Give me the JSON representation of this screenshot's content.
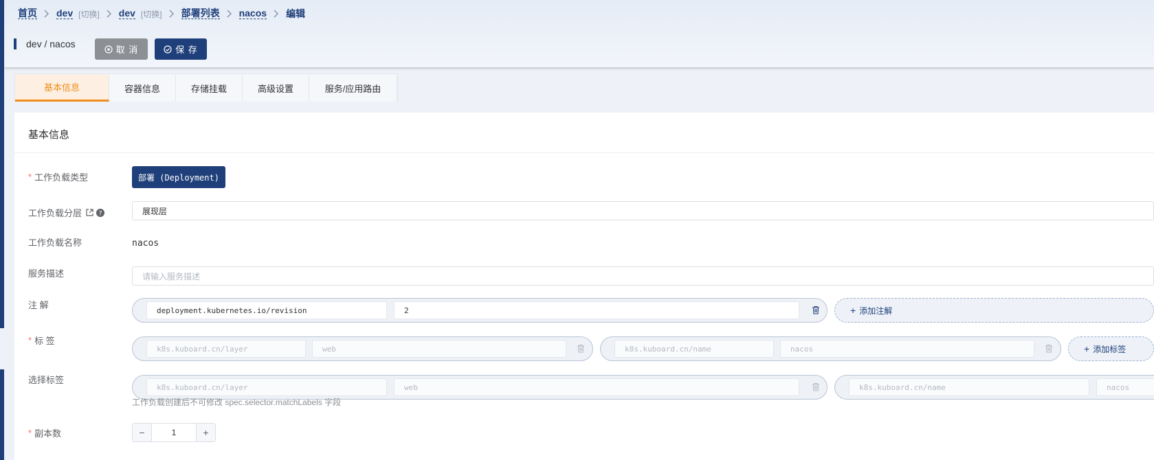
{
  "breadcrumb": {
    "home": "首页",
    "cluster": "dev",
    "cluster_switch": "[切换]",
    "namespace": "dev",
    "namespace_switch": "[切换]",
    "list": "部署列表",
    "item": "nacos",
    "current": "编辑"
  },
  "header": {
    "title": "dev / nacos",
    "cancel_label": "取 消",
    "save_label": "保 存"
  },
  "tabs": [
    {
      "label": "基本信息",
      "active": true
    },
    {
      "label": "容器信息",
      "active": false
    },
    {
      "label": "存储挂载",
      "active": false
    },
    {
      "label": "高级设置",
      "active": false
    },
    {
      "label": "服务/应用路由",
      "active": false
    }
  ],
  "form": {
    "section_title": "基本信息",
    "workload_type": {
      "label": "工作负载类型",
      "required": true,
      "value": "部署 (Deployment)"
    },
    "workload_layer": {
      "label": "工作负载分层",
      "value": "展现层"
    },
    "workload_name": {
      "label": "工作负载名称",
      "value": "nacos"
    },
    "description": {
      "label": "服务描述",
      "placeholder": "请输入服务描述"
    },
    "annotations": {
      "label": "注 解",
      "items": [
        {
          "key": "deployment.kubernetes.io/revision",
          "value": "2"
        }
      ],
      "add_label": "添加注解"
    },
    "labels": {
      "label": "标 签",
      "required": true,
      "items": [
        {
          "key": "k8s.kuboard.cn/layer",
          "value": "web"
        },
        {
          "key": "k8s.kuboard.cn/name",
          "value": "nacos"
        }
      ],
      "add_label": "添加标签"
    },
    "selector": {
      "label": "选择标签",
      "items": [
        {
          "key": "k8s.kuboard.cn/layer",
          "value": "web"
        },
        {
          "key": "k8s.kuboard.cn/name",
          "value": "nacos"
        }
      ],
      "hint": "工作负载创建后不可修改 spec.selector.matchLabels 字段"
    },
    "replicas": {
      "label": "副本数",
      "required": true,
      "value": "1",
      "minus": "−",
      "plus": "+"
    }
  },
  "colors": {
    "primary": "#1f3f7a",
    "accent": "#f08c1a",
    "required": "#f56c6c"
  }
}
